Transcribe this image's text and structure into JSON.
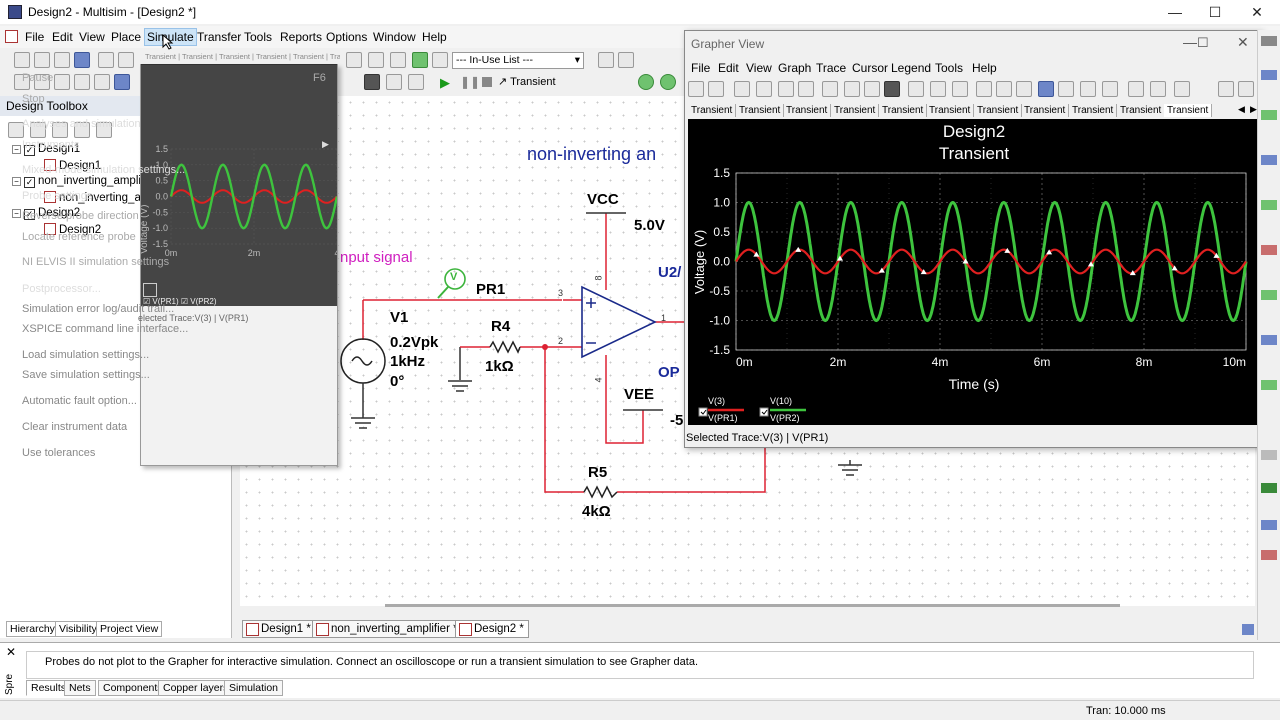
{
  "window": {
    "title": "Design2 - Multisim - [Design2 *]",
    "minimize": "—",
    "maximize": "☐",
    "close": "✕"
  },
  "menubar": [
    "File",
    "Edit",
    "View",
    "Place",
    "Simulate",
    "Transfer",
    "Tools",
    "Reports",
    "Options",
    "Window",
    "Help"
  ],
  "toolbar": {
    "inuse_list": "--- In-Use List ---",
    "analysis": "Transient"
  },
  "toolbox": {
    "title": "Design Toolbox",
    "tree": [
      "Design1",
      "Design1",
      "non_inverting_amplifier",
      "non_inverting_amplifier",
      "Design2",
      "Design2"
    ],
    "tabs": [
      "Hierarchy",
      "Visibility",
      "Project View"
    ]
  },
  "simulate_menu": {
    "items": [
      "Pause",
      "Stop",
      "Analyses and simulation",
      "Instruments",
      "Mixed-mode simulation settings...",
      "Probe settings...",
      "Reverse probe direction",
      "Locate reference probe",
      "NI ELVIS II simulation settings",
      "Postprocessor...",
      "Simulation error log/audit trail...",
      "XSPICE command line interface...",
      "Load simulation settings...",
      "Save simulation settings...",
      "Automatic fault option...",
      "Clear instrument data",
      "Use tolerances"
    ],
    "pause_shortcut": "F6",
    "ghost_tabs": [
      "Transient",
      "Transient",
      "Transient",
      "Transient",
      "Transient",
      "Tra"
    ],
    "ghost_selected": "elected Trace:V(3) | V(PR1)",
    "ghost_ylabel": "Voltage (V)",
    "ghost_legend": [
      "V(PR1)",
      "V(PR2)"
    ],
    "ghost_ticks_y": [
      "1.5",
      "1.0",
      "0.5",
      "0.0",
      "-0.5",
      "-1.0",
      "-1.5"
    ],
    "ghost_ticks_x": [
      "0m",
      "2m",
      "4"
    ]
  },
  "schematic": {
    "title": "non-inverting an",
    "input_label": "nput signal",
    "vcc": "VCC",
    "vcc_value": "5.0V",
    "vee": "VEE",
    "vee_value": "-5",
    "pr1": "PR1",
    "v1_name": "V1",
    "v1_vpk": "0.2Vpk",
    "v1_freq": "1kHz",
    "v1_phase": "0°",
    "r4_name": "R4",
    "r4_value": "1kΩ",
    "r5_name": "R5",
    "r5_value": "4kΩ",
    "u2": "U2/",
    "op": "OP",
    "probe_v": "V",
    "node_3": "3",
    "node_2": "2",
    "node_1": "1",
    "pin_8": "8",
    "pin_4": "4"
  },
  "grapher": {
    "title": "Grapher View",
    "menu": [
      "File",
      "Edit",
      "View",
      "Graph",
      "Trace",
      "Cursor",
      "Legend",
      "Tools",
      "Help"
    ],
    "tabs": [
      "Transient",
      "Transient",
      "Transient",
      "Transient",
      "Transient",
      "Transient",
      "Transient",
      "Transient",
      "Transient",
      "Transient",
      "Transient"
    ],
    "selected_trace": "Selected Trace:V(3) | V(PR1)"
  },
  "chart_data": {
    "type": "line",
    "title": "Design2",
    "subtitle": "Transient",
    "xlabel": "Time (s)",
    "ylabel": "Voltage (V)",
    "xlim": [
      0,
      10
    ],
    "ylim": [
      -1.5,
      1.5
    ],
    "x_ticks": [
      "0m",
      "2m",
      "4m",
      "6m",
      "8m",
      "10m"
    ],
    "y_ticks": [
      "1.5",
      "1.0",
      "0.5",
      "0.0",
      "-0.5",
      "-1.0",
      "-1.5"
    ],
    "grid": true,
    "legend_placement": "bottom-left",
    "series": [
      {
        "name": "V(PR1)",
        "legend_top": "V(3)",
        "amplitude": 0.2,
        "frequency_khz": 1,
        "color": "#e02020"
      },
      {
        "name": "V(PR2)",
        "legend_top": "V(10)",
        "amplitude": 1.0,
        "frequency_khz": 1,
        "color": "#3ec43e"
      }
    ]
  },
  "doc_tabs": [
    "Design1 *",
    "non_inverting_amplifier *",
    "Design2 *"
  ],
  "spreadsheet": {
    "label": "Spre",
    "message": "Probes do not plot to the Grapher for interactive simulation. Connect an oscilloscope or run a transient simulation to see Grapher data.",
    "tabs": [
      "Results",
      "Nets",
      "Components",
      "Copper layers",
      "Simulation"
    ]
  },
  "status": {
    "tran": "Tran: 10.000 ms"
  }
}
